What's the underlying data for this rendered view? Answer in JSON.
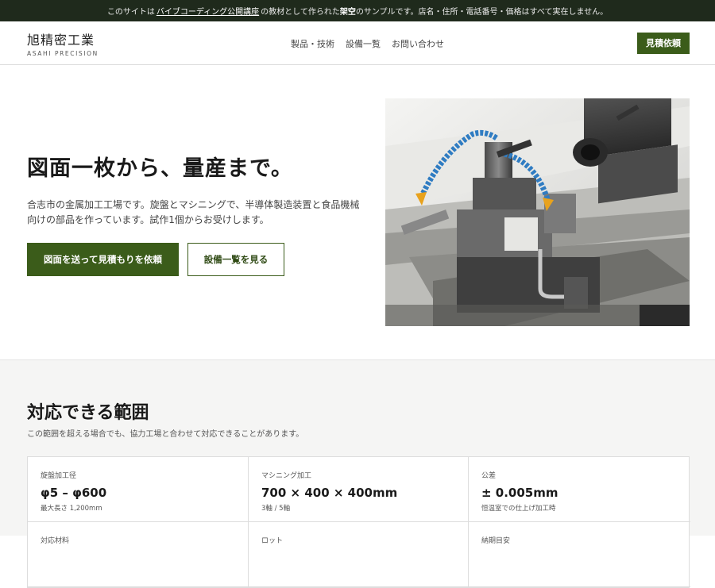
{
  "notice": {
    "prefix": "このサイトは",
    "link": "バイブコーディング公開講座",
    "mid": "の教材として作られた",
    "bold": "架空",
    "suffix": "のサンプルです。店名・住所・電話番号・価格はすべて実在しません。"
  },
  "header": {
    "logo_ja": "旭精密工業",
    "logo_en": "ASAHI PRECISION",
    "nav": [
      "製品・技術",
      "設備一覧",
      "お問い合わせ"
    ],
    "cta": "見積依頼"
  },
  "hero": {
    "title": "図面一枚から、量産まで。",
    "desc_line1": "合志市の金属加工工場です。旋盤とマシニングで、半導体製造装置と食品機械",
    "desc_line2": "向けの部品を作っています。試作1個からお受けします。",
    "btn_primary": "図面を送って見積もりを依頼",
    "btn_secondary": "設備一覧を見る"
  },
  "range": {
    "title": "対応できる範囲",
    "subtitle": "この範囲を超える場合でも、協力工場と合わせて対応できることがあります。",
    "cells": [
      {
        "label": "旋盤加工径",
        "value": "φ5 – φ600",
        "note": "最大長さ 1,200mm"
      },
      {
        "label": "マシニング加工",
        "value": "700 × 400 × 400mm",
        "note": "3軸 / 5軸"
      },
      {
        "label": "公差",
        "value": "± 0.005mm",
        "note": "恒温室での仕上げ加工時"
      },
      {
        "label": "対応材料",
        "value": "",
        "note": ""
      },
      {
        "label": "ロット",
        "value": "",
        "note": ""
      },
      {
        "label": "納期目安",
        "value": "",
        "note": ""
      }
    ]
  }
}
